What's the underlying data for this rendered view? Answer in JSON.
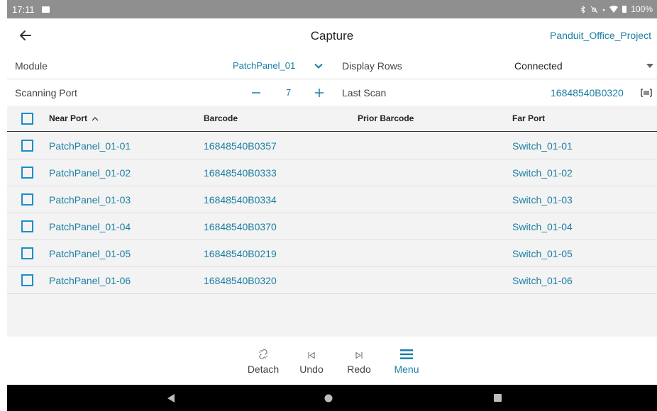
{
  "status_bar": {
    "time": "17:11",
    "battery": "100%"
  },
  "app_bar": {
    "title": "Capture",
    "project": "Panduit_Office_Project"
  },
  "form": {
    "module_label": "Module",
    "module_value": "PatchPanel_01",
    "display_rows_label": "Display Rows",
    "display_rows_value": "Connected",
    "scanning_port_label": "Scanning Port",
    "scanning_port_value": "7",
    "last_scan_label": "Last Scan",
    "last_scan_value": "16848540B0320"
  },
  "table": {
    "headers": {
      "near_port": "Near Port",
      "barcode": "Barcode",
      "prior_barcode": "Prior Barcode",
      "far_port": "Far Port"
    },
    "rows": [
      {
        "near_port": "PatchPanel_01-01",
        "barcode": "16848540B0357",
        "prior_barcode": "",
        "far_port": "Switch_01-01"
      },
      {
        "near_port": "PatchPanel_01-02",
        "barcode": "16848540B0333",
        "prior_barcode": "",
        "far_port": "Switch_01-02"
      },
      {
        "near_port": "PatchPanel_01-03",
        "barcode": "16848540B0334",
        "prior_barcode": "",
        "far_port": "Switch_01-03"
      },
      {
        "near_port": "PatchPanel_01-04",
        "barcode": "16848540B0370",
        "prior_barcode": "",
        "far_port": "Switch_01-04"
      },
      {
        "near_port": "PatchPanel_01-05",
        "barcode": "16848540B0219",
        "prior_barcode": "",
        "far_port": "Switch_01-05"
      },
      {
        "near_port": "PatchPanel_01-06",
        "barcode": "16848540B0320",
        "prior_barcode": "",
        "far_port": "Switch_01-06"
      }
    ]
  },
  "toolbar": {
    "detach": "Detach",
    "undo": "Undo",
    "redo": "Redo",
    "menu": "Menu"
  },
  "colors": {
    "accent": "#1b7fa3",
    "checkbox": "#1b8ec9",
    "status_bar": "#8f8f8f",
    "table_bg": "#f3f3f3"
  },
  "icons": [
    "back-arrow-icon",
    "chevron-down-icon",
    "dropdown-triangle-icon",
    "minus-icon",
    "plus-icon",
    "barcode-scan-icon",
    "sort-up-icon",
    "detach-icon",
    "undo-icon",
    "redo-icon",
    "menu-icon",
    "nav-back-icon",
    "nav-home-icon",
    "nav-recents-icon",
    "bluetooth-icon",
    "mute-icon",
    "wifi-icon",
    "battery-icon"
  ]
}
